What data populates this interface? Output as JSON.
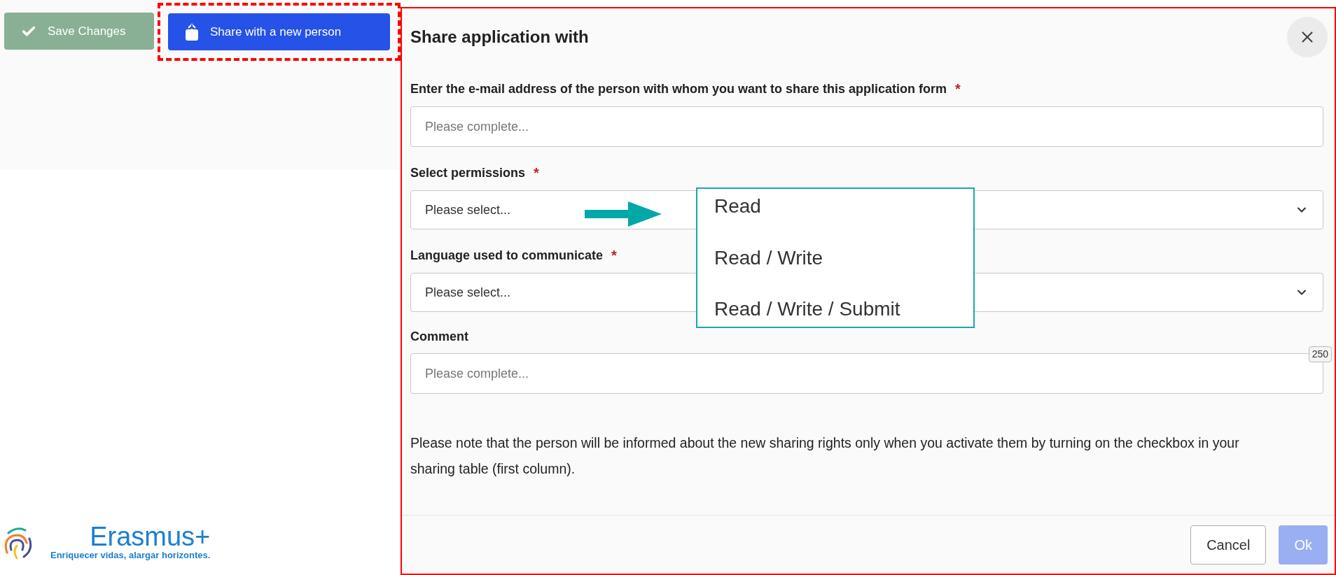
{
  "toolbar": {
    "buttons": [
      {
        "kind": "save",
        "label": "Save Changes"
      },
      {
        "kind": "share",
        "label": "Share with a new person"
      }
    ]
  },
  "logo": {
    "name": "Erasmus+",
    "tagline": "Enriquecer vidas, alargar horizontes."
  },
  "dialog": {
    "title": "Share application with",
    "fields": [
      {
        "kind": "text",
        "label": "Enter the e-mail address of the person with whom you want to share this application form",
        "marker": "*",
        "placeholder": "Please complete..."
      },
      {
        "kind": "select",
        "label": "Select permissions",
        "marker": "*",
        "placeholder": "Please select..."
      },
      {
        "kind": "select",
        "label": "Language used to communicate",
        "marker": "*",
        "placeholder": "Please select..."
      },
      {
        "kind": "text",
        "label": "Comment",
        "placeholder": "Please complete...",
        "counter": "250"
      }
    ],
    "note": "Please note that the person will be informed about the new sharing rights only when you activate them by turning on the checkbox in your sharing table (first column).",
    "buttons": [
      {
        "kind": "secondary",
        "label": "Cancel",
        "disabled": false
      },
      {
        "kind": "primary",
        "label": "Ok",
        "disabled": true
      }
    ]
  },
  "permission_options": [
    "Read",
    "Read / Write",
    "Read / Write / Submit"
  ]
}
